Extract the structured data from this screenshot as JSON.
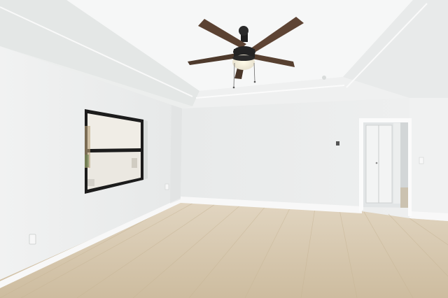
{
  "scene": {
    "kind": "empty room interior",
    "fixtures": [
      "ceiling-fan",
      "interior-window",
      "doorway",
      "closet-door",
      "light-switch",
      "wall-outlet"
    ],
    "colors": {
      "wall": "#eef0ef",
      "wall_shadow": "#e2e5e4",
      "ceiling": "#f4f5f5",
      "floor": "#d6c7ad",
      "fan_blade": "#5b4232",
      "window_frame": "#1c1c1c"
    }
  }
}
